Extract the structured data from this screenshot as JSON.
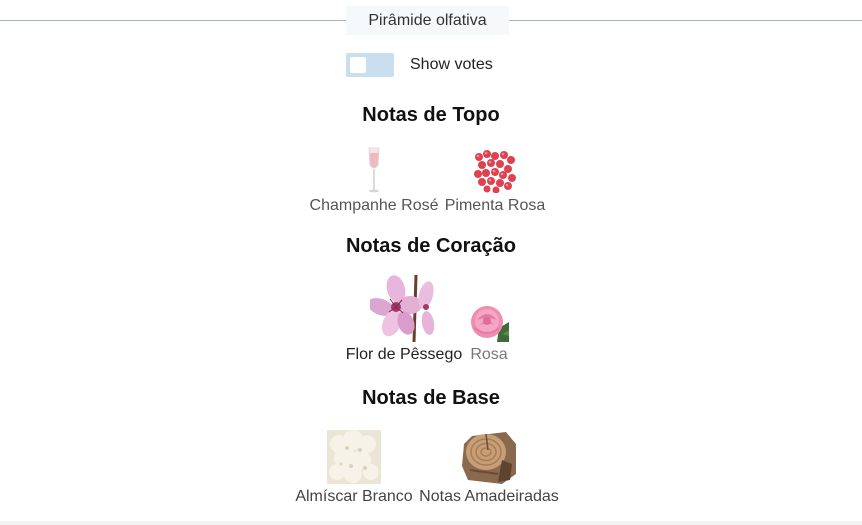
{
  "pyramid": {
    "title": "Pirâmide olfativa",
    "show_votes_label": "Show votes",
    "show_votes_enabled": false,
    "tiers": [
      {
        "title": "Notas de Topo",
        "notes": [
          {
            "name": "Champanhe Rosé",
            "icon": "champagne-glass-icon"
          },
          {
            "name": "Pimenta Rosa",
            "icon": "pink-pepper-icon"
          }
        ]
      },
      {
        "title": "Notas de Coração",
        "notes": [
          {
            "name": "Flor de Pêssego",
            "icon": "peach-blossom-icon"
          },
          {
            "name": "Rosa",
            "icon": "rose-icon"
          }
        ]
      },
      {
        "title": "Notas de Base",
        "notes": [
          {
            "name": "Almíscar Branco",
            "icon": "white-musk-icon"
          },
          {
            "name": "Notas Amadeiradas",
            "icon": "woody-notes-icon"
          }
        ]
      }
    ]
  },
  "colors": {
    "rule": "#9fb6bf",
    "toggle_track": "#c9dff0",
    "title_bg": "#f5f9fc"
  }
}
